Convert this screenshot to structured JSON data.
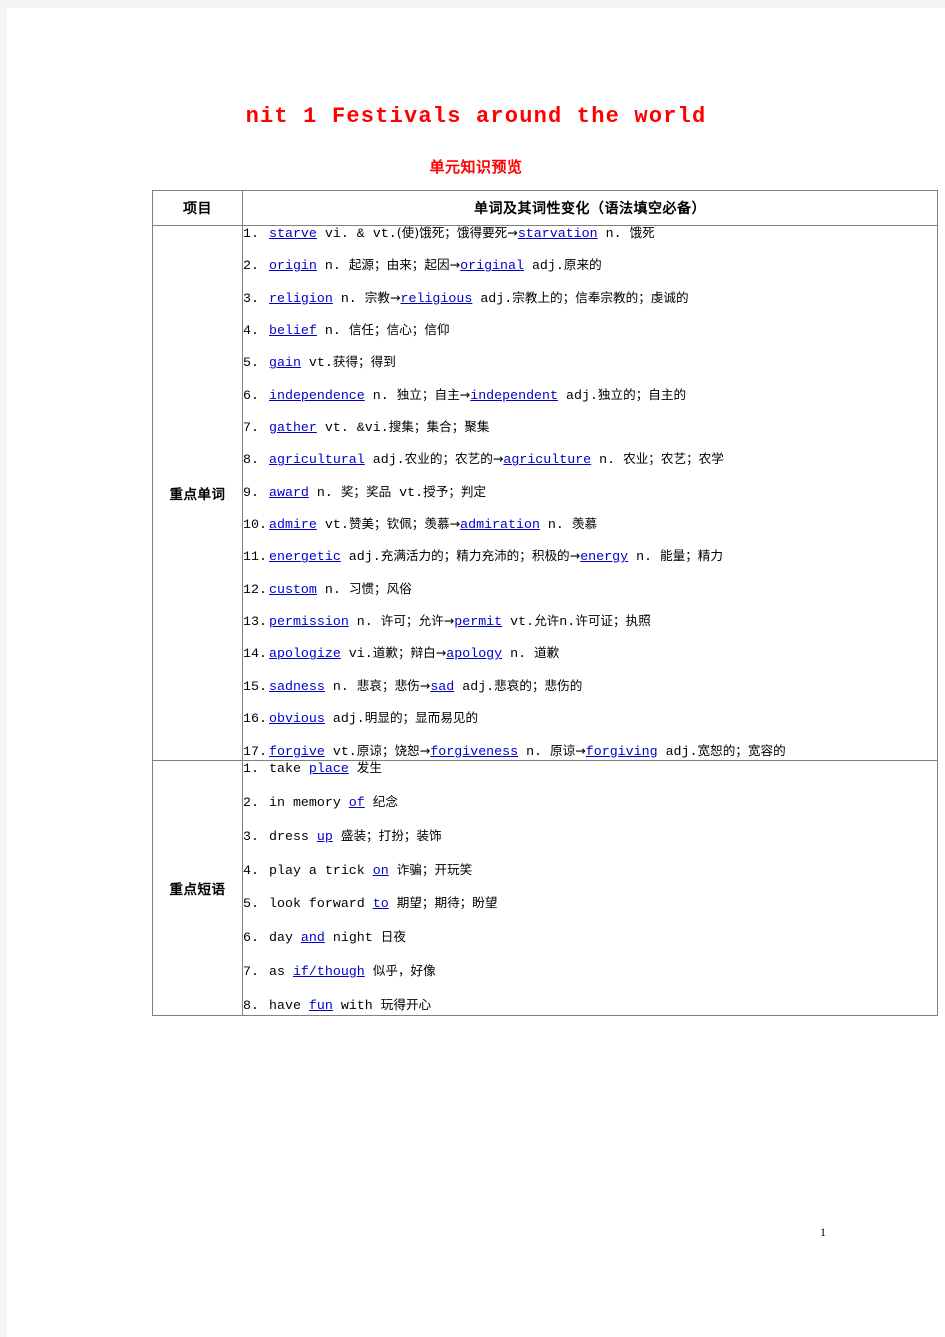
{
  "document": {
    "title": "nit 1 Festivals around the world",
    "subtitle": "单元知识预览",
    "page_number": "1",
    "title_color": "#ff0000",
    "link_color": "#0000cc"
  },
  "table": {
    "header": {
      "label_column": "项目",
      "content_column": "单词及其词性变化（语法填空必备）"
    },
    "sections": [
      {
        "label": "重点单词",
        "entries": [
          {
            "num": "1.",
            "parts": [
              {
                "t": "w",
                "v": "starve"
              },
              {
                "t": "p",
                "v": " vi. & vt."
              },
              {
                "t": "cn",
                "v": "(使)饿死；饿得要死"
              },
              {
                "t": "ar",
                "v": "→"
              },
              {
                "t": "w",
                "v": "starvation"
              },
              {
                "t": "p",
                "v": " n. "
              },
              {
                "t": "cn",
                "v": "饿死"
              }
            ]
          },
          {
            "num": "2.",
            "parts": [
              {
                "t": "w",
                "v": "origin"
              },
              {
                "t": "p",
                "v": " n. "
              },
              {
                "t": "cn",
                "v": "起源；由来；起因"
              },
              {
                "t": "ar",
                "v": "→"
              },
              {
                "t": "w",
                "v": "original"
              },
              {
                "t": "p",
                "v": " adj."
              },
              {
                "t": "cn",
                "v": "原来的"
              }
            ]
          },
          {
            "num": "3.",
            "parts": [
              {
                "t": "w",
                "v": "religion"
              },
              {
                "t": "p",
                "v": " n. "
              },
              {
                "t": "cn",
                "v": "宗教"
              },
              {
                "t": "ar",
                "v": "→"
              },
              {
                "t": "w",
                "v": "religious"
              },
              {
                "t": "p",
                "v": " adj."
              },
              {
                "t": "cn",
                "v": "宗教上的；信奉宗教的；虔诚的"
              }
            ]
          },
          {
            "num": "4.",
            "parts": [
              {
                "t": "w",
                "v": "belief"
              },
              {
                "t": "p",
                "v": " n. "
              },
              {
                "t": "cn",
                "v": "信任；信心；信仰"
              }
            ]
          },
          {
            "num": "5.",
            "parts": [
              {
                "t": "w",
                "v": "gain"
              },
              {
                "t": "p",
                "v": " vt."
              },
              {
                "t": "cn",
                "v": "获得；得到"
              }
            ]
          },
          {
            "num": "6.",
            "parts": [
              {
                "t": "w",
                "v": "independence"
              },
              {
                "t": "p",
                "v": " n. "
              },
              {
                "t": "cn",
                "v": "独立；自主"
              },
              {
                "t": "ar",
                "v": "→"
              },
              {
                "t": "w",
                "v": "independent"
              },
              {
                "t": "p",
                "v": " adj."
              },
              {
                "t": "cn",
                "v": "独立的；自主的"
              }
            ]
          },
          {
            "num": "7.",
            "parts": [
              {
                "t": "w",
                "v": "gather"
              },
              {
                "t": "p",
                "v": " vt. &vi."
              },
              {
                "t": "cn",
                "v": "搜集；集合；聚集"
              }
            ]
          },
          {
            "num": "8.",
            "parts": [
              {
                "t": "w",
                "v": "agricultural"
              },
              {
                "t": "p",
                "v": " adj."
              },
              {
                "t": "cn",
                "v": "农业的；农艺的"
              },
              {
                "t": "ar",
                "v": "→"
              },
              {
                "t": "w",
                "v": "agriculture"
              },
              {
                "t": "p",
                "v": " n. "
              },
              {
                "t": "cn",
                "v": "农业；农艺；农学"
              }
            ]
          },
          {
            "num": "9.",
            "parts": [
              {
                "t": "w",
                "v": "award"
              },
              {
                "t": "p",
                "v": " n. "
              },
              {
                "t": "cn",
                "v": "奖；奖品"
              },
              {
                "t": "p",
                "v": " vt."
              },
              {
                "t": "cn",
                "v": "授予；判定"
              }
            ]
          },
          {
            "num": "10.",
            "parts": [
              {
                "t": "w",
                "v": "admire"
              },
              {
                "t": "p",
                "v": " vt."
              },
              {
                "t": "cn",
                "v": "赞美；钦佩；羡慕"
              },
              {
                "t": "ar",
                "v": "→"
              },
              {
                "t": "w",
                "v": "admiration"
              },
              {
                "t": "p",
                "v": " n. "
              },
              {
                "t": "cn",
                "v": "羡慕"
              }
            ]
          },
          {
            "num": "11.",
            "parts": [
              {
                "t": "w",
                "v": "energetic"
              },
              {
                "t": "p",
                "v": " adj."
              },
              {
                "t": "cn",
                "v": "充满活力的；精力充沛的；积极的"
              },
              {
                "t": "ar",
                "v": "→"
              },
              {
                "t": "w",
                "v": "energy"
              },
              {
                "t": "p",
                "v": " n. "
              },
              {
                "t": "cn",
                "v": "能量；精力"
              }
            ]
          },
          {
            "num": "12.",
            "parts": [
              {
                "t": "w",
                "v": "custom"
              },
              {
                "t": "p",
                "v": " n. "
              },
              {
                "t": "cn",
                "v": "习惯；风俗"
              }
            ]
          },
          {
            "num": "13.",
            "parts": [
              {
                "t": "w",
                "v": "permission"
              },
              {
                "t": "p",
                "v": " n. "
              },
              {
                "t": "cn",
                "v": "许可；允许"
              },
              {
                "t": "ar",
                "v": "→"
              },
              {
                "t": "w",
                "v": "permit"
              },
              {
                "t": "p",
                "v": " vt."
              },
              {
                "t": "cn",
                "v": "允许"
              },
              {
                "t": "p",
                "v": "n."
              },
              {
                "t": "cn",
                "v": "许可证；执照"
              }
            ]
          },
          {
            "num": "14.",
            "parts": [
              {
                "t": "w",
                "v": "apologize"
              },
              {
                "t": "p",
                "v": " vi."
              },
              {
                "t": "cn",
                "v": "道歉；辩白"
              },
              {
                "t": "ar",
                "v": "→"
              },
              {
                "t": "w",
                "v": "apology"
              },
              {
                "t": "p",
                "v": " n. "
              },
              {
                "t": "cn",
                "v": "道歉"
              }
            ]
          },
          {
            "num": "15.",
            "parts": [
              {
                "t": "w",
                "v": "sadness"
              },
              {
                "t": "p",
                "v": " n. "
              },
              {
                "t": "cn",
                "v": "悲哀；悲伤"
              },
              {
                "t": "ar",
                "v": "→"
              },
              {
                "t": "w",
                "v": "sad"
              },
              {
                "t": "p",
                "v": " adj."
              },
              {
                "t": "cn",
                "v": "悲哀的；悲伤的"
              }
            ]
          },
          {
            "num": "16.",
            "parts": [
              {
                "t": "w",
                "v": "obvious"
              },
              {
                "t": "p",
                "v": " adj."
              },
              {
                "t": "cn",
                "v": "明显的；显而易见的"
              }
            ]
          },
          {
            "num": "17.",
            "parts": [
              {
                "t": "w",
                "v": "forgive"
              },
              {
                "t": "p",
                "v": " vt."
              },
              {
                "t": "cn",
                "v": "原谅；饶恕"
              },
              {
                "t": "ar",
                "v": "→"
              },
              {
                "t": "w",
                "v": "forgiveness"
              },
              {
                "t": "p",
                "v": " n. "
              },
              {
                "t": "cn",
                "v": "原谅"
              },
              {
                "t": "ar",
                "v": "→"
              },
              {
                "t": "w",
                "v": "forgiving"
              },
              {
                "t": "p",
                "v": " adj."
              },
              {
                "t": "cn",
                "v": "宽恕的；宽容的"
              }
            ]
          }
        ]
      },
      {
        "label": "重点短语",
        "entries": [
          {
            "num": "1.",
            "parts": [
              {
                "t": "p",
                "v": "take "
              },
              {
                "t": "w",
                "v": "place"
              },
              {
                "t": "p",
                "v": " "
              },
              {
                "t": "cn",
                "v": "发生"
              }
            ]
          },
          {
            "num": "2.",
            "parts": [
              {
                "t": "p",
                "v": "in memory "
              },
              {
                "t": "w",
                "v": "of"
              },
              {
                "t": "p",
                "v": "  "
              },
              {
                "t": "cn",
                "v": "纪念"
              }
            ]
          },
          {
            "num": "3.",
            "parts": [
              {
                "t": "p",
                "v": "dress "
              },
              {
                "t": "w",
                "v": "up"
              },
              {
                "t": "p",
                "v": "  "
              },
              {
                "t": "cn",
                "v": "盛装；打扮；装饰"
              }
            ]
          },
          {
            "num": "4.",
            "parts": [
              {
                "t": "p",
                "v": "play a trick "
              },
              {
                "t": "w",
                "v": "on"
              },
              {
                "t": "p",
                "v": "  "
              },
              {
                "t": "cn",
                "v": "诈骗；开玩笑"
              }
            ]
          },
          {
            "num": "5.",
            "parts": [
              {
                "t": "p",
                "v": "look forward "
              },
              {
                "t": "w",
                "v": "to"
              },
              {
                "t": "p",
                "v": "  "
              },
              {
                "t": "cn",
                "v": "期望；期待；盼望"
              }
            ]
          },
          {
            "num": "6.",
            "parts": [
              {
                "t": "p",
                "v": "day "
              },
              {
                "t": "w",
                "v": "and"
              },
              {
                "t": "p",
                "v": " night  "
              },
              {
                "t": "cn",
                "v": "日夜"
              }
            ]
          },
          {
            "num": "7.",
            "parts": [
              {
                "t": "p",
                "v": "as "
              },
              {
                "t": "w",
                "v": "if/though"
              },
              {
                "t": "p",
                "v": "  "
              },
              {
                "t": "cn",
                "v": "似乎，好像"
              }
            ]
          },
          {
            "num": "8.",
            "parts": [
              {
                "t": "p",
                "v": "have "
              },
              {
                "t": "w",
                "v": "fun"
              },
              {
                "t": "p",
                "v": " with  "
              },
              {
                "t": "cn",
                "v": "玩得开心"
              }
            ]
          }
        ]
      }
    ]
  }
}
